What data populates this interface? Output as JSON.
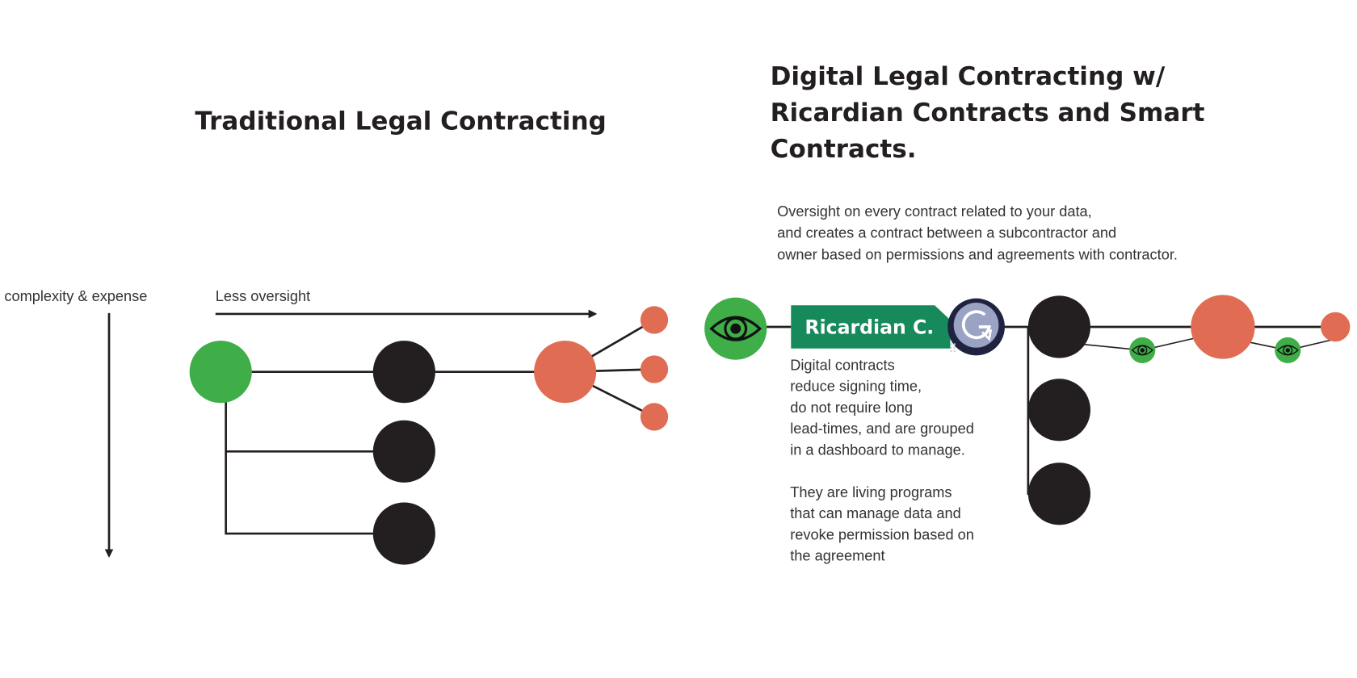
{
  "colors": {
    "green": "#3fae49",
    "black": "#231f20",
    "orange": "#e06c53",
    "banner": "#178a5c",
    "badge_dark": "#1f2340",
    "badge_light": "#9aa3c4"
  },
  "left": {
    "title": "Traditional Legal Contracting",
    "vertical_axis_label": "complexity & expense",
    "horizontal_axis_label": "Less oversight"
  },
  "right": {
    "title_lines": [
      "Digital Legal Contracting w/",
      "Ricardian Contracts and Smart",
      "Contracts."
    ],
    "subtitle_lines": [
      "Oversight on every contract related to your data,",
      "and creates a contract between a subcontractor and",
      "owner based on permissions and agreements with contractor."
    ],
    "banner_label": "Ricardian C.",
    "badge_icon": "refresh-g-icon",
    "oversight_icon": "eye-icon",
    "description_lines": [
      "Digital contracts",
      "reduce signing time,",
      "do not require long",
      "lead-times, and are grouped",
      "in a dashboard to manage."
    ],
    "description2_lines": [
      "They are living programs",
      "that can manage data and",
      "revoke permission based on",
      "the agreement"
    ]
  }
}
